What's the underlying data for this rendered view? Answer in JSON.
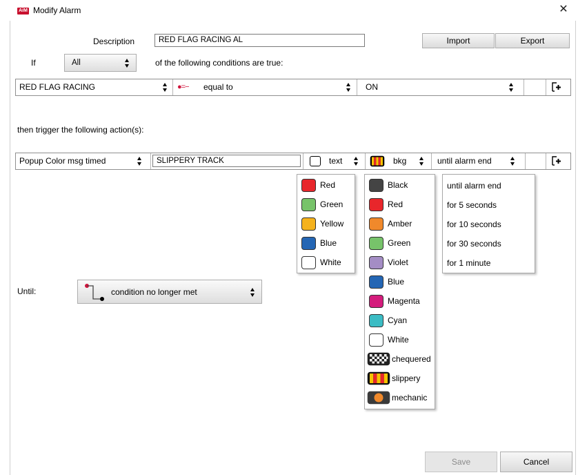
{
  "window": {
    "title": "Modify Alarm",
    "icon_text": "AiM",
    "close_glyph": "✕"
  },
  "header": {
    "description_label": "Description",
    "description_value": "RED FLAG RACING AL",
    "import_label": "Import",
    "export_label": "Export",
    "if_label": "If",
    "if_select_value": "All",
    "conditions_text": "of the following conditions are true:"
  },
  "condition_row": {
    "channel": "RED FLAG RACING",
    "operator_symbol": "●=−",
    "operator": "equal to",
    "value": "ON"
  },
  "action_intro": "then trigger the following action(s):",
  "action_row": {
    "action": "Popup Color msg timed",
    "message": "SLIPPERY TRACK",
    "text_label": "text",
    "bkg_label": "bkg",
    "duration": "until alarm end"
  },
  "text_color_menu": [
    {
      "label": "Red",
      "color": "#e8262b"
    },
    {
      "label": "Green",
      "color": "#77c36a"
    },
    {
      "label": "Yellow",
      "color": "#f5b21c"
    },
    {
      "label": "Blue",
      "color": "#2466b4"
    },
    {
      "label": "White",
      "color": "#ffffff"
    }
  ],
  "bkg_color_menu": [
    {
      "label": "Black",
      "color": "#444444",
      "pattern": "solid"
    },
    {
      "label": "Red",
      "color": "#e8262b",
      "pattern": "solid"
    },
    {
      "label": "Amber",
      "color": "#f0892b",
      "pattern": "solid"
    },
    {
      "label": "Green",
      "color": "#77c36a",
      "pattern": "solid"
    },
    {
      "label": "Violet",
      "color": "#a48dc5",
      "pattern": "solid"
    },
    {
      "label": "Blue",
      "color": "#2466b4",
      "pattern": "solid"
    },
    {
      "label": "Magenta",
      "color": "#d41c7c",
      "pattern": "solid"
    },
    {
      "label": "Cyan",
      "color": "#3bbcc4",
      "pattern": "solid"
    },
    {
      "label": "White",
      "color": "#ffffff",
      "pattern": "solid"
    },
    {
      "label": "chequered",
      "color": "#000000",
      "pattern": "chequered"
    },
    {
      "label": "slippery",
      "color": "#e8262b",
      "pattern": "slippery"
    },
    {
      "label": "mechanic",
      "color": "#f0892b",
      "pattern": "mechanic"
    }
  ],
  "duration_menu": [
    "until alarm end",
    "for 5 seconds",
    "for 10 seconds",
    "for 30 seconds",
    "for 1 minute"
  ],
  "until": {
    "label": "Until:",
    "value": "condition no longer met"
  },
  "footer": {
    "save_label": "Save",
    "cancel_label": "Cancel"
  }
}
